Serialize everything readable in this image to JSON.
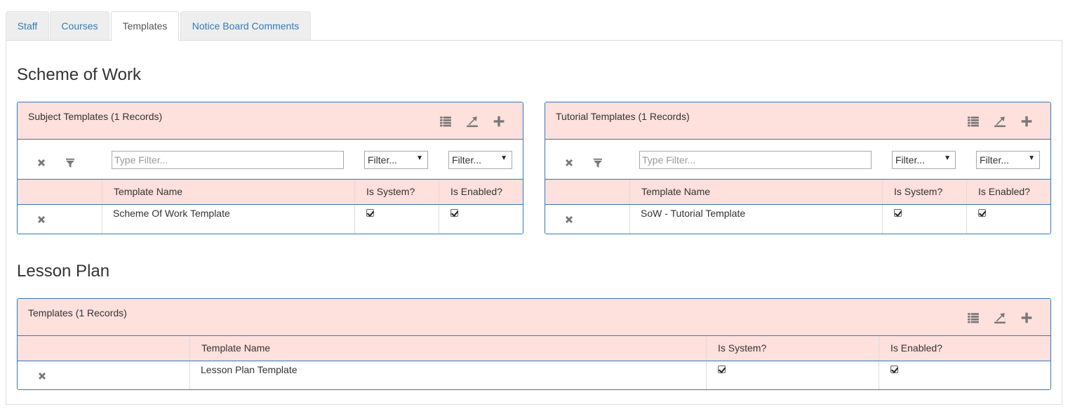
{
  "tabs": [
    {
      "label": "Staff",
      "active": false
    },
    {
      "label": "Courses",
      "active": false
    },
    {
      "label": "Templates",
      "active": true
    },
    {
      "label": "Notice Board Comments",
      "active": false
    }
  ],
  "sections": {
    "scheme_of_work": {
      "title": "Scheme of Work",
      "subject_panel": {
        "title": "Subject Templates (1 Records)",
        "filter": {
          "text_placeholder": "Type Filter...",
          "select1": "Filter...",
          "select2": "Filter..."
        },
        "columns": [
          "Template Name",
          "Is System?",
          "Is Enabled?"
        ],
        "rows": [
          {
            "name": "Scheme Of Work Template",
            "is_system": true,
            "is_enabled": true
          }
        ]
      },
      "tutorial_panel": {
        "title": "Tutorial Templates (1 Records)",
        "filter": {
          "text_placeholder": "Type Filter...",
          "select1": "Filter...",
          "select2": "Filter..."
        },
        "columns": [
          "Template Name",
          "Is System?",
          "Is Enabled?"
        ],
        "rows": [
          {
            "name": "SoW - Tutorial Template",
            "is_system": true,
            "is_enabled": true
          }
        ]
      }
    },
    "lesson_plan": {
      "title": "Lesson Plan",
      "templates_panel": {
        "title": "Templates (1 Records)",
        "columns": [
          "Template Name",
          "Is System?",
          "Is Enabled?"
        ],
        "rows": [
          {
            "name": "Lesson Plan Template",
            "is_system": true,
            "is_enabled": true
          }
        ]
      }
    }
  },
  "icons": {
    "list": "list-icon",
    "export": "export-icon",
    "add": "plus-icon",
    "clear": "close-icon",
    "filter": "filter-icon"
  },
  "colors": {
    "panel_header": "#fee0dd",
    "panel_border": "#337ab7",
    "link": "#337ab7"
  }
}
